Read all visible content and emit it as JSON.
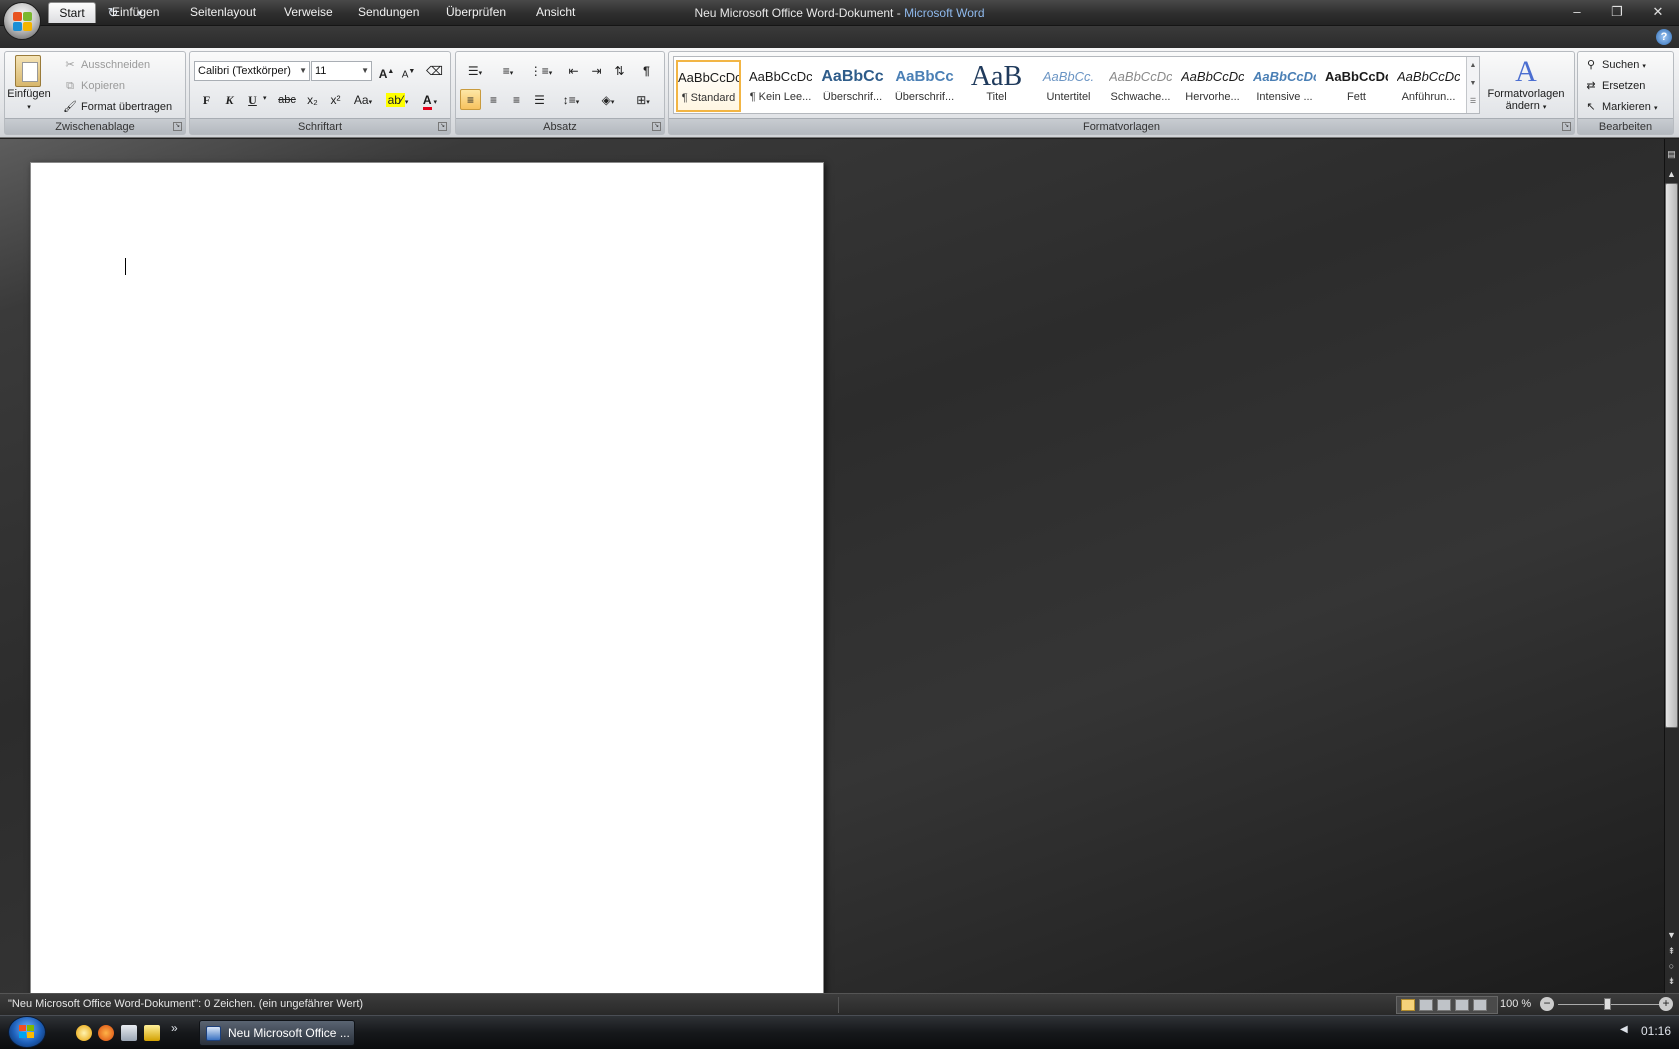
{
  "window": {
    "title_doc": "Neu Microsoft Office Word-Dokument",
    "title_sep": " - ",
    "title_app": "Microsoft Word"
  },
  "tabs": [
    {
      "label": "Start",
      "active": true
    },
    {
      "label": "Einfügen"
    },
    {
      "label": "Seitenlayout"
    },
    {
      "label": "Verweise"
    },
    {
      "label": "Sendungen"
    },
    {
      "label": "Überprüfen"
    },
    {
      "label": "Ansicht"
    }
  ],
  "clipboard": {
    "paste": "Einfügen",
    "cut": "Ausschneiden",
    "copy": "Kopieren",
    "format_painter": "Format übertragen",
    "group": "Zwischenablage"
  },
  "font": {
    "name": "Calibri (Textkörper)",
    "size": "11",
    "group": "Schriftart",
    "bold": "F",
    "italic": "K",
    "underline": "U",
    "strike": "abc",
    "subscript": "x₂",
    "superscript": "x²",
    "change_case": "Aa",
    "grow": "A",
    "shrink": "A",
    "font_color": "A"
  },
  "paragraph": {
    "group": "Absatz",
    "pilcrow": "¶"
  },
  "styles": {
    "group": "Formatvorlagen",
    "items": [
      {
        "sample": "AaBbCcDc",
        "label": "¶ Standard"
      },
      {
        "sample": "AaBbCcDc",
        "label": "¶ Kein Lee..."
      },
      {
        "sample": "AaBbCc",
        "label": "Überschrif..."
      },
      {
        "sample": "AaBbCc",
        "label": "Überschrif..."
      },
      {
        "sample": "AaB",
        "label": "Titel"
      },
      {
        "sample": "AaBbCc.",
        "label": "Untertitel"
      },
      {
        "sample": "AaBbCcDc",
        "label": "Schwache..."
      },
      {
        "sample": "AaBbCcDc",
        "label": "Hervorhe..."
      },
      {
        "sample": "AaBbCcDc",
        "label": "Intensive ..."
      },
      {
        "sample": "AaBbCcDc",
        "label": "Fett"
      },
      {
        "sample": "AaBbCcDc",
        "label": "Anführun..."
      }
    ],
    "change_line1": "Formatvorlagen",
    "change_line2": "ändern"
  },
  "editing": {
    "group": "Bearbeiten",
    "find": "Suchen",
    "replace": "Ersetzen",
    "select": "Markieren"
  },
  "statusbar": {
    "text": "\"Neu Microsoft Office Word-Dokument\": 0 Zeichen. (ein ungefährer Wert)",
    "zoom": "100 %"
  },
  "taskbar": {
    "word_task": "Neu Microsoft Office ...",
    "clock": "01:16",
    "more": "»"
  },
  "colors": {
    "highlight": "#ffff00",
    "font_color": "#e3001b",
    "selected_style_border": "#f2b544"
  }
}
